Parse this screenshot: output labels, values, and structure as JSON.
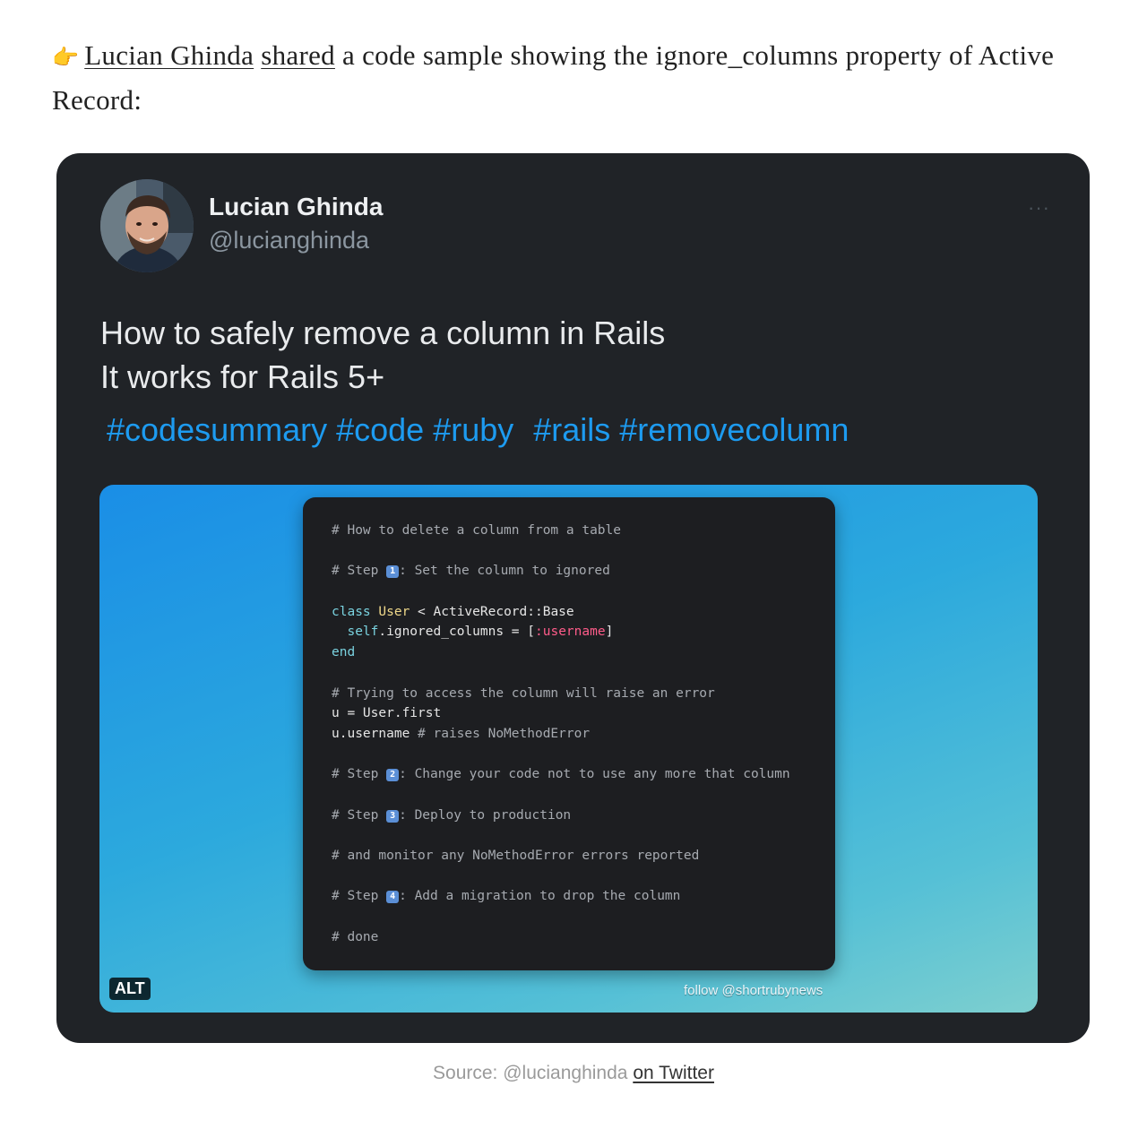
{
  "intro": {
    "pointing_emoji": "👉",
    "author_link": "Lucian Ghinda",
    "shared_link": "shared",
    "text_rest": " a code sample showing the ignore_columns property of Active Record:"
  },
  "tweet": {
    "author_name": "Lucian Ghinda",
    "author_handle": "@lucianghinda",
    "more_label": "···",
    "text_line1": "How to safely remove a column in Rails",
    "text_line2": "It works for Rails 5+",
    "hashtags": [
      "#codesummary",
      "#code",
      "#ruby",
      " #rails",
      "#removecolumn"
    ],
    "media": {
      "alt_label": "ALT",
      "follow_text": "follow @shortrubynews",
      "gradient_colors": [
        "#1a8ee6",
        "#2ca9dd",
        "#55c0d6",
        "#7dcfcf"
      ],
      "code": {
        "c1": "# How to delete a column from a table",
        "step1_pre": "# Step ",
        "step1_num": "1",
        "step1_post": ": Set the column to ignored",
        "kw_class": "class",
        "cls_user": "User",
        "inherit": " < ActiveRecord::Base",
        "self_kw": "self",
        "ignored_columns": ".ignored_columns = [",
        "symbol": ":username",
        "close_bracket": "]",
        "kw_end": "end",
        "c_try": "# Trying to access the column will raise an error",
        "assign": "u = User.first",
        "call": "u.username ",
        "c_raises": "# raises NoMethodError",
        "step2_pre": "# Step ",
        "step2_num": "2",
        "step2_post": ": Change your code not to use any more that column",
        "step3_pre": "# Step ",
        "step3_num": "3",
        "step3_post": ": Deploy to production",
        "c_monitor": "# and monitor any NoMethodError errors reported",
        "step4_pre": "# Step ",
        "step4_num": "4",
        "step4_post": ": Add a migration to drop the column",
        "c_done": "# done"
      }
    }
  },
  "source": {
    "prefix": "Source: @lucianghinda ",
    "link": "on Twitter"
  },
  "colors": {
    "tweet_bg": "#202327",
    "hashtag": "#1d9bf0",
    "code_bg": "#1d1e21"
  }
}
